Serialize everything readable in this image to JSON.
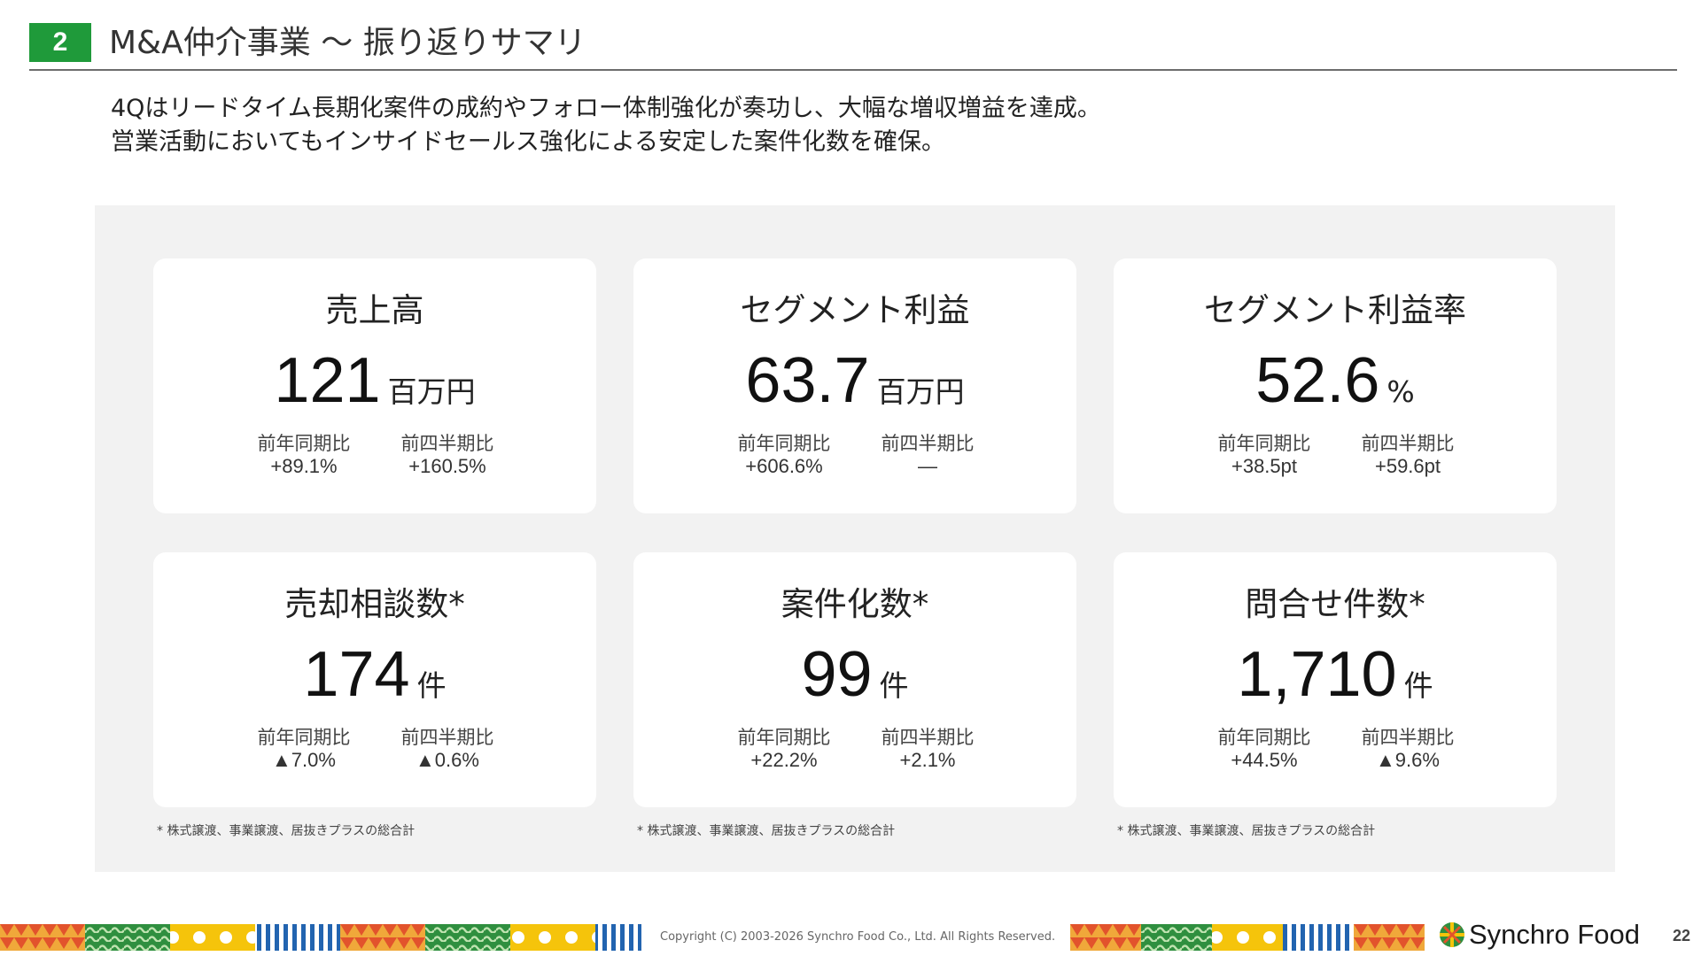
{
  "header": {
    "section_number": "2",
    "title": "M&A仲介事業 ～ 振り返りサマリ"
  },
  "lead": [
    "4Qはリードタイム長期化案件の成約やフォロー体制強化が奏功し、大幅な増収増益を達成。",
    "営業活動においてもインサイドセールス強化による安定した案件化数を確保。"
  ],
  "cards": [
    {
      "title": "売上高",
      "value": "121",
      "unit": "百万円",
      "yoy_label": "前年同期比",
      "yoy": "+89.1%",
      "qoq_label": "前四半期比",
      "qoq": "+160.5%"
    },
    {
      "title": "セグメント利益",
      "value": "63.7",
      "unit": "百万円",
      "yoy_label": "前年同期比",
      "yoy": "+606.6%",
      "qoq_label": "前四半期比",
      "qoq": "—"
    },
    {
      "title": "セグメント利益率",
      "value": "52.6",
      "unit": "%",
      "yoy_label": "前年同期比",
      "yoy": "+38.5pt",
      "qoq_label": "前四半期比",
      "qoq": "+59.6pt"
    },
    {
      "title": "売却相談数*",
      "value": "174",
      "unit": "件",
      "yoy_label": "前年同期比",
      "yoy": "▲7.0%",
      "qoq_label": "前四半期比",
      "qoq": "▲0.6%"
    },
    {
      "title": "案件化数*",
      "value": "99",
      "unit": "件",
      "yoy_label": "前年同期比",
      "yoy": "+22.2%",
      "qoq_label": "前四半期比",
      "qoq": "+2.1%"
    },
    {
      "title": "問合せ件数*",
      "value": "1,710",
      "unit": "件",
      "yoy_label": "前年同期比",
      "yoy": "+44.5%",
      "qoq_label": "前四半期比",
      "qoq": "▲9.6%"
    }
  ],
  "notes": [
    "* 株式譲渡、事業譲渡、居抜きプラスの総合計",
    "* 株式譲渡、事業譲渡、居抜きプラスの総合計",
    "* 株式譲渡、事業譲渡、居抜きプラスの総合計"
  ],
  "footer": {
    "copyright": "Copyright (C) 2003-2026 Synchro Food Co., Ltd. All Rights Reserved.",
    "logo_text": "Synchro Food",
    "page_number": "22"
  },
  "colors": {
    "accent_green": "#1f9a3a",
    "panel_gray": "#f2f2f2"
  }
}
